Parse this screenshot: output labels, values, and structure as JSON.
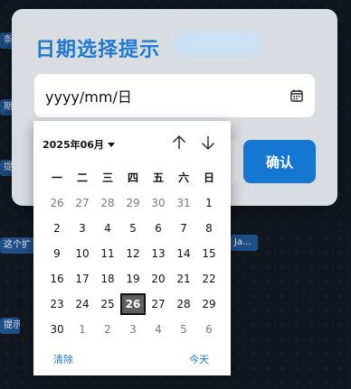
{
  "background": {
    "fragments": [
      "条提",
      "期选",
      "提供",
      "这个扩",
      "提示",
      "Ja..."
    ]
  },
  "dialog": {
    "title": "日期选择提示",
    "input": {
      "value": "yyyy/mm/日",
      "icon": "calendar-icon"
    },
    "confirm_label": "确认"
  },
  "calendar": {
    "month_label": "2025年06月",
    "nav": {
      "up_icon": "arrow-up-icon",
      "down_icon": "arrow-down-icon"
    },
    "weekdays": [
      "一",
      "二",
      "三",
      "四",
      "五",
      "六",
      "日"
    ],
    "weeks": [
      [
        "26",
        "27",
        "28",
        "29",
        "30",
        "31",
        "1"
      ],
      [
        "2",
        "3",
        "4",
        "5",
        "6",
        "7",
        "8"
      ],
      [
        "9",
        "10",
        "11",
        "12",
        "13",
        "14",
        "15"
      ],
      [
        "16",
        "17",
        "18",
        "19",
        "20",
        "21",
        "22"
      ],
      [
        "23",
        "24",
        "25",
        "26",
        "27",
        "28",
        "29"
      ],
      [
        "30",
        "1",
        "2",
        "3",
        "4",
        "5",
        "6"
      ]
    ],
    "selected_day": "26",
    "clear_label": "清除",
    "today_label": "今天"
  },
  "colors": {
    "accent": "#1677d2",
    "title": "#1f78d1",
    "selected_bg": "#5f5f5f"
  }
}
